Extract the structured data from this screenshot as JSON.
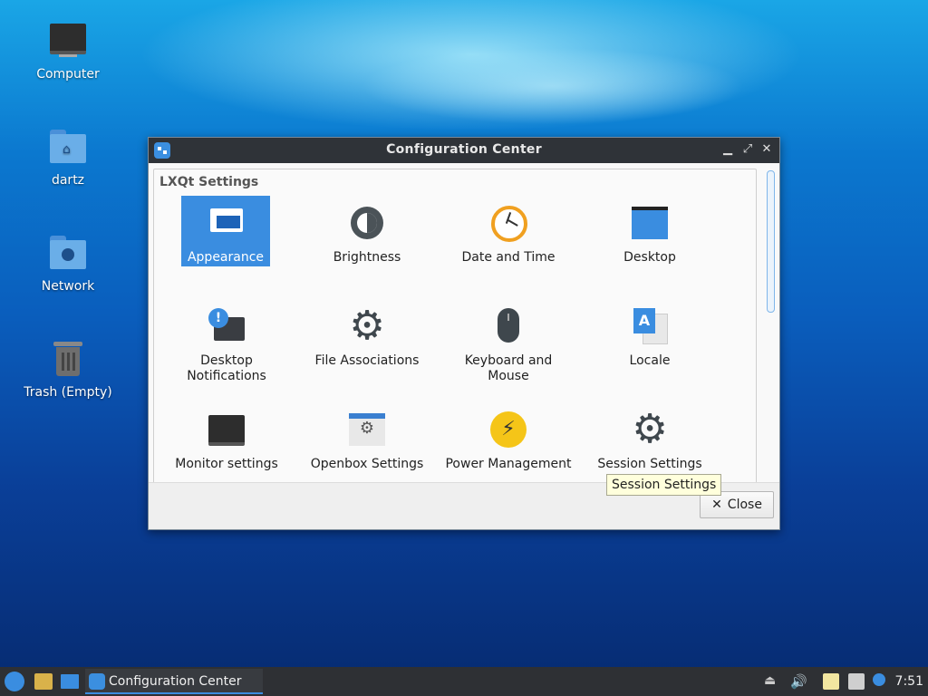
{
  "desktop": {
    "icons": [
      {
        "label": "Computer",
        "icon": "computer-icon"
      },
      {
        "label": "dartz",
        "icon": "home-folder-icon"
      },
      {
        "label": "Network",
        "icon": "network-folder-icon"
      },
      {
        "label": "Trash (Empty)",
        "icon": "trash-icon"
      }
    ]
  },
  "window": {
    "title": "Configuration Center",
    "controls": {
      "minimize": "▁",
      "maximize": "⤢",
      "close": "✕"
    },
    "group_title": "LXQt Settings",
    "items": [
      {
        "label": "Appearance",
        "icon": "appearance-icon",
        "selected": true
      },
      {
        "label": "Brightness",
        "icon": "brightness-icon"
      },
      {
        "label": "Date and Time",
        "icon": "clock-icon"
      },
      {
        "label": "Desktop",
        "icon": "desktop-icon"
      },
      {
        "label": "Desktop Notifications",
        "icon": "notification-icon"
      },
      {
        "label": "File Associations",
        "icon": "gear-icon"
      },
      {
        "label": "Keyboard and Mouse",
        "icon": "mouse-icon"
      },
      {
        "label": "Locale",
        "icon": "locale-icon"
      },
      {
        "label": "Monitor settings",
        "icon": "monitor-icon"
      },
      {
        "label": "Openbox Settings",
        "icon": "openbox-icon"
      },
      {
        "label": "Power Management",
        "icon": "power-icon"
      },
      {
        "label": "Session Settings",
        "icon": "gear-icon"
      }
    ],
    "tooltip": "Session Settings",
    "close_label": "Close",
    "close_glyph": "✕"
  },
  "taskbar": {
    "task_label": "Configuration Center",
    "clock": "7:51"
  },
  "colors": {
    "accent": "#3a8de0",
    "titlebar": "#2f3338",
    "taskbar": "#2e3034"
  }
}
